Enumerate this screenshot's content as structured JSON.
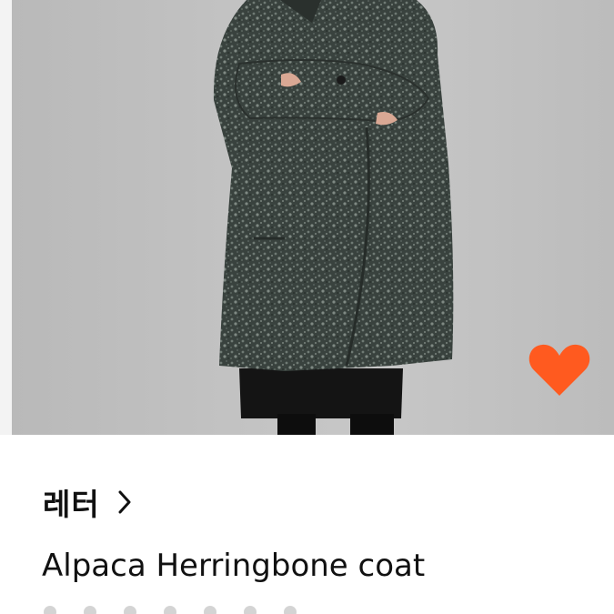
{
  "product": {
    "brand": "레터",
    "title": "Alpaca Herringbone coat"
  },
  "icons": {
    "like": "heart-icon",
    "brand_arrow": "chevron-right-icon"
  },
  "colors": {
    "like_heart": "#ff5a1f",
    "text": "#111111",
    "image_background": "#c2c2c2",
    "coat": "#3b4440"
  }
}
